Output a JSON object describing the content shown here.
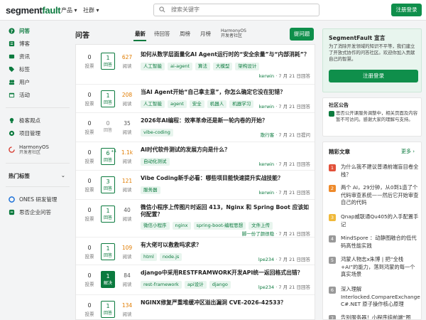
{
  "nav": {
    "logo_seg": "segment",
    "logo_fault": "fault",
    "product": "产品 ▾",
    "community": "社群 ▾",
    "search_placeholder": "搜索关键字",
    "login": "注册登录"
  },
  "sidebar": {
    "items": [
      {
        "label": "问答",
        "icon": "question-icon"
      },
      {
        "label": "博客",
        "icon": "blog-icon"
      },
      {
        "label": "资讯",
        "icon": "news-icon"
      },
      {
        "label": "标签",
        "icon": "tag-icon"
      },
      {
        "label": "用户",
        "icon": "users-icon"
      },
      {
        "label": "活动",
        "icon": "calendar-icon"
      }
    ],
    "items2": [
      {
        "label": "极客观点",
        "icon": "lightbulb-icon"
      },
      {
        "label": "项目管理",
        "icon": "project-icon"
      }
    ],
    "harmony_title": "HarmonyOS",
    "harmony_sub": "开发者社区",
    "hot_tags": "热门标签",
    "items3": [
      {
        "label": "ONES 研发管理"
      },
      {
        "label": "思否企业问答"
      }
    ]
  },
  "main": {
    "title": "问答",
    "tabs": [
      "最新",
      "待回答",
      "周榜",
      "月榜"
    ],
    "harmony_tab_title": "HarmonyOS",
    "harmony_tab_sub": "开发者社区",
    "ask": "提问题",
    "votes_label": "投票",
    "answers_label": "回答",
    "solved_label": "解决",
    "views_label": "阅读",
    "questions": [
      {
        "votes": "0",
        "answers": "1",
        "ans_state": "answered",
        "views": "627",
        "views_color": "orange",
        "title": "如何从数学层面量化AI Agent运行时的“安全余量”与“内部消耗”？",
        "tags": [
          "人工智能",
          "ai-agent",
          "算法",
          "大模型",
          "架构设计"
        ],
        "author": "kerwin",
        "time": " · 7 月 21 日回答"
      },
      {
        "votes": "0",
        "answers": "1",
        "ans_state": "answered",
        "views": "208",
        "views_color": "orange",
        "title": "当AI Agent开始“自己拿主意”，你怎么确定它没在犯错？",
        "tags": [
          "人工智能",
          "agent",
          "安全",
          "机器人",
          "机器学习"
        ],
        "author": "kerwin",
        "time": " · 7 月 21 日回答"
      },
      {
        "votes": "0",
        "answers": "0",
        "ans_state": "none",
        "views": "35",
        "views_color": "grey",
        "title": "2026年AI编程：效率革命还是新一轮内卷的开始？",
        "tags": [
          "vibe-coding"
        ],
        "author": "散行客",
        "time": " · 7 月 21 日提问"
      },
      {
        "votes": "0",
        "answers": "6",
        "answers_sup": "+1",
        "ans_state": "answered",
        "views": "1.1k",
        "views_color": "orange",
        "title": "AI时代软件测试的发展方向是什么？",
        "tags": [
          "自动化测试"
        ],
        "author": "kerwin",
        "time": " · 7 月 21 日回答"
      },
      {
        "votes": "0",
        "answers": "3",
        "ans_state": "answered",
        "views": "121",
        "views_color": "orange",
        "title": "Vibe Coding新手必看：哪些项目能快速提升实战技能？",
        "tags": [
          "服务器"
        ],
        "author": "kerwin",
        "time": " · 7 月 21 日回答"
      },
      {
        "votes": "0",
        "answers": "1",
        "ans_state": "answered",
        "views": "40",
        "views_color": "grey",
        "title": "微信小程序上传图片时返回 413，Nginx 和 Spring Boot 应该如何配置？",
        "tags": [
          "微信小程序",
          "nginx",
          "spring-boot-编程思想",
          "文件上传"
        ],
        "author": "脚一份了颜很稳",
        "time": " · 7 月 21 日回答"
      },
      {
        "votes": "0",
        "answers": "1",
        "ans_state": "answered",
        "views": "109",
        "views_color": "orange",
        "title": "有大佬可以救救吗求求？",
        "tags": [
          "html",
          "node.js"
        ],
        "author": "lpe234",
        "time": " · 7 月 21 日回答"
      },
      {
        "votes": "0",
        "answers": "1",
        "ans_state": "solved",
        "views": "84",
        "views_color": "grey",
        "title": "django中采用RESTFRAMWORK开发API统一返回格式出错？",
        "tags": [
          "rest-framework",
          "api设计",
          "django"
        ],
        "author": "lpe234",
        "time": " · 7 月 21 日回答"
      },
      {
        "votes": "0",
        "answers": "1",
        "ans_state": "answered",
        "views": "134",
        "views_color": "orange",
        "title": "NGINX修复严重堆缓冲区溢出漏洞 CVE-2026-42533？",
        "tags": [],
        "author": "",
        "time": ""
      }
    ]
  },
  "promo": {
    "title": "SegmentFault 宣言",
    "text": "为了消除开发领域的知识不平等，我们建立了开放式协作的问答社区。欢迎你加入贡献自己的智慧。",
    "button": "注册登录"
  },
  "notice": {
    "title": "社区公告",
    "text": "思否公开课服务调整中，相关页面及内容暂不可访问。感谢大家的理解与支持。"
  },
  "articles": {
    "title": "精彩文章",
    "more": "更多 ›",
    "items": [
      {
        "rank": "1",
        "title": "为什么我不建议普通前端盲目卷全栈？",
        "color": "#e2513a"
      },
      {
        "rank": "2",
        "title": "两个 AI，29分钟，从0到1造了个代码审查系统——然后它开始审查自己的代码",
        "color": "#ee8a2b"
      },
      {
        "rank": "3",
        "title": "Qnap威联通Qu405的入手配置手记",
        "color": "#f0b93a"
      },
      {
        "rank": "4",
        "title": "MindSpore ：动静图融合的低代码高性能实践",
        "color": "#999999"
      },
      {
        "rank": "5",
        "title": "鸿蒙人物志x朱博 | 把“全栈+AI”的能力，落到鸿蒙的每一个真实场景",
        "color": "#999999"
      },
      {
        "rank": "6",
        "title": "深入理解 Interlocked.CompareExchange：C#.NET 原子操作核心原理",
        "color": "#999999"
      },
      {
        "rank": "7",
        "title": "告别服务器！小程序纯前端“图",
        "color": "#999999"
      }
    ]
  }
}
